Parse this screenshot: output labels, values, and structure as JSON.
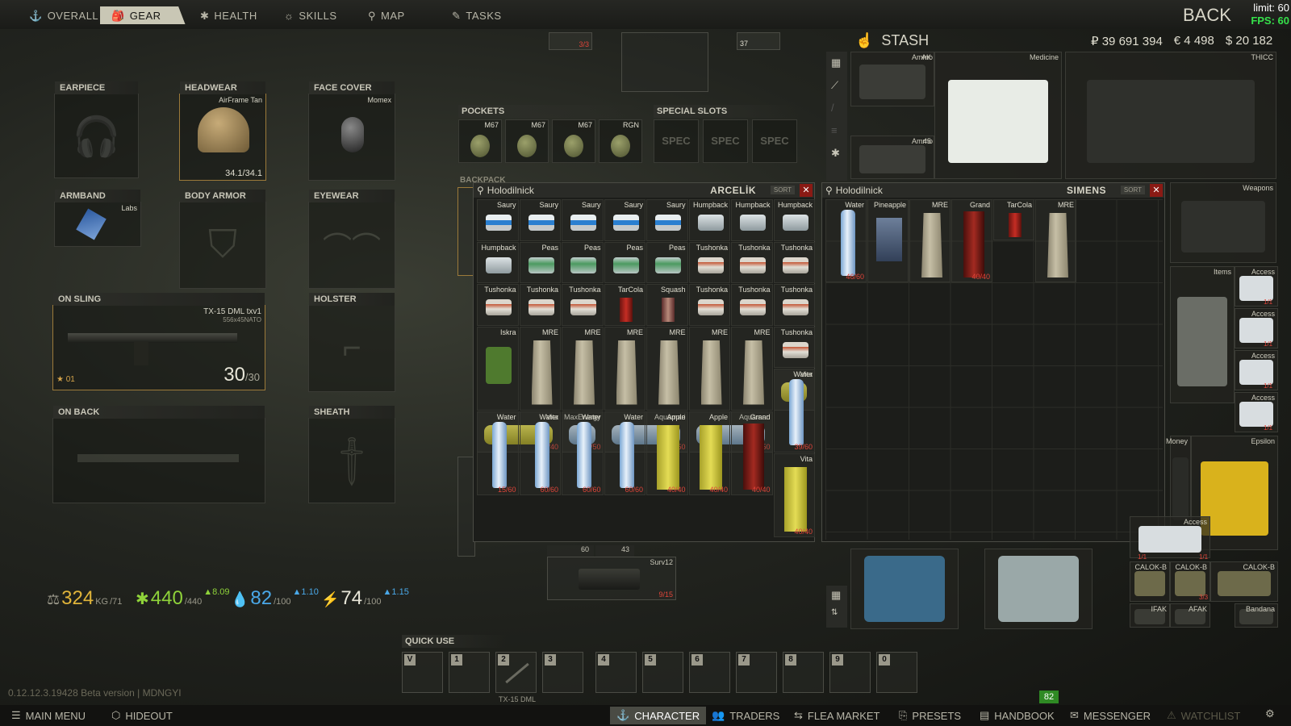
{
  "top_tabs": [
    {
      "label": "OVERALL",
      "icon": "anchor-icon"
    },
    {
      "label": "GEAR",
      "icon": "backpack-icon"
    },
    {
      "label": "HEALTH",
      "icon": "health-icon"
    },
    {
      "label": "SKILLS",
      "icon": "skills-icon"
    },
    {
      "label": "MAP",
      "icon": "map-pin-icon"
    },
    {
      "label": "TASKS",
      "icon": "tasks-icon"
    }
  ],
  "back_label": "BACK",
  "limit_label": "limit: 60",
  "fps_label": "FPS: 60",
  "gear_slots": {
    "earpiece": {
      "title": "EARPIECE",
      "item": ""
    },
    "headwear": {
      "title": "HEADWEAR",
      "item": "AirFrame Tan",
      "durability": "34.1/34.1"
    },
    "face_cover": {
      "title": "FACE COVER",
      "item": "Momex"
    },
    "armband": {
      "title": "ARMBAND",
      "item": "Labs"
    },
    "body_armor": {
      "title": "BODY ARMOR",
      "item": ""
    },
    "eyewear": {
      "title": "EYEWEAR",
      "item": ""
    },
    "on_sling": {
      "title": "ON SLING",
      "item": "TX-15 DML txv1",
      "caliber": "556x45NATO",
      "ammo": "30",
      "ammo_max": "/30",
      "badge": "01"
    },
    "holster": {
      "title": "HOLSTER",
      "item": ""
    },
    "on_back": {
      "title": "ON BACK",
      "item": ""
    },
    "sheath": {
      "title": "SHEATH",
      "item": ""
    }
  },
  "top_mid": {
    "item_a_count": "3/3",
    "item_b_count": "37"
  },
  "pockets": {
    "title": "POCKETS",
    "items": [
      "M67",
      "M67",
      "M67",
      "RGN"
    ]
  },
  "special": {
    "title": "SPECIAL SLOTS",
    "items": [
      "SPEC",
      "SPEC",
      "SPEC"
    ]
  },
  "backpack_label": "BACKPACK",
  "stats": {
    "weight": "324",
    "weight_unit": "KG",
    "weight_max": "/71",
    "health": "440",
    "health_max": "/440",
    "health_rate": "▲8.09",
    "hydration": "82",
    "hydration_max": "/100",
    "hydration_rate": "▲1.10",
    "energy": "74",
    "energy_max": "/100",
    "energy_rate": "▲1.15"
  },
  "quick_use": {
    "title": "QUICK USE",
    "keys": [
      "V",
      "1",
      "2",
      "3",
      "4",
      "5",
      "6",
      "7",
      "8",
      "9",
      "0"
    ],
    "slot2_item": "TX-15 DML"
  },
  "version": "0.12.12.3.19428 Beta version | MDNGYI",
  "bottom_nav": [
    {
      "label": "MAIN MENU",
      "icon": "menu-icon"
    },
    {
      "label": "HIDEOUT",
      "icon": "hideout-icon"
    },
    {
      "label": "CHARACTER",
      "icon": "character-icon"
    },
    {
      "label": "TRADERS",
      "icon": "traders-icon"
    },
    {
      "label": "FLEA MARKET",
      "icon": "flea-icon"
    },
    {
      "label": "PRESETS",
      "icon": "presets-icon"
    },
    {
      "label": "HANDBOOK",
      "icon": "handbook-icon"
    },
    {
      "label": "MESSENGER",
      "icon": "messenger-icon"
    },
    {
      "label": "WATCHLIST",
      "icon": "watchlist-icon"
    }
  ],
  "level_badge": "82",
  "stash": {
    "title": "STASH",
    "rubles": "₽ 39 691 394",
    "euros": "€ 4 498",
    "dollars": "$ 20 182",
    "containers": [
      "AK",
      "Ammo",
      "Medicine",
      "THICC",
      ".45",
      "Ammo",
      "Weapons",
      "Items",
      "Access",
      "Access",
      "Access",
      "Access",
      "Money",
      "Epsilon",
      "Access",
      "CALOK-B",
      "CALOK-B",
      "IFAK",
      "AFAK",
      "CALOK-B",
      "Bandana"
    ],
    "container_counts": [
      "1/1",
      "1/1",
      "1/1",
      "1/1",
      "1/1",
      "1/1",
      "3/3"
    ]
  },
  "fridge_left": {
    "title": "Holodilnick",
    "brand": "ARCELİK",
    "sort": "SORT",
    "rows": [
      [
        "Saury",
        "Saury",
        "Saury",
        "Saury",
        "Saury",
        "Humpback",
        "Humpback",
        "Humpback"
      ],
      [
        "Humpback",
        "Peas",
        "Peas",
        "Peas",
        "Peas",
        "Tushonka",
        "Tushonka",
        "Tushonka"
      ],
      [
        "Tushonka",
        "Tushonka",
        "Tushonka",
        "TarCola",
        "Squash",
        "Tushonka",
        "Tushonka",
        "Tushonka"
      ],
      [
        "Iskra",
        "MRE",
        "MRE",
        "MRE",
        "MRE",
        "MRE",
        "MRE",
        "Tushonka"
      ],
      [
        "Water",
        "Water",
        "Water",
        "Water",
        "Apple",
        "Apple",
        "Grand",
        "Vita"
      ],
      [
        "Vita",
        "MaxEnergy",
        "Aquamari",
        "Aquamari"
      ]
    ],
    "side_water": {
      "name": "Water",
      "count": "39/60"
    },
    "counts_row5": [
      "15/60",
      "60/60",
      "60/60",
      "60/60",
      "40/40",
      "40/40",
      "40/40",
      "40/40"
    ],
    "counts_row6": [
      "40/40",
      "50/50",
      "50/50"
    ]
  },
  "fridge_right": {
    "title": "Holodilnick",
    "brand": "SIMENS",
    "sort": "SORT",
    "items": [
      "Water",
      "Pineapple",
      "MRE",
      "Grand",
      "TarCola",
      "MRE"
    ],
    "counts": [
      "46/60",
      "40/40"
    ]
  },
  "bottom_mid": {
    "left_count": "60",
    "right_count": "43",
    "item": "Surv12",
    "item_count": "9/15"
  }
}
